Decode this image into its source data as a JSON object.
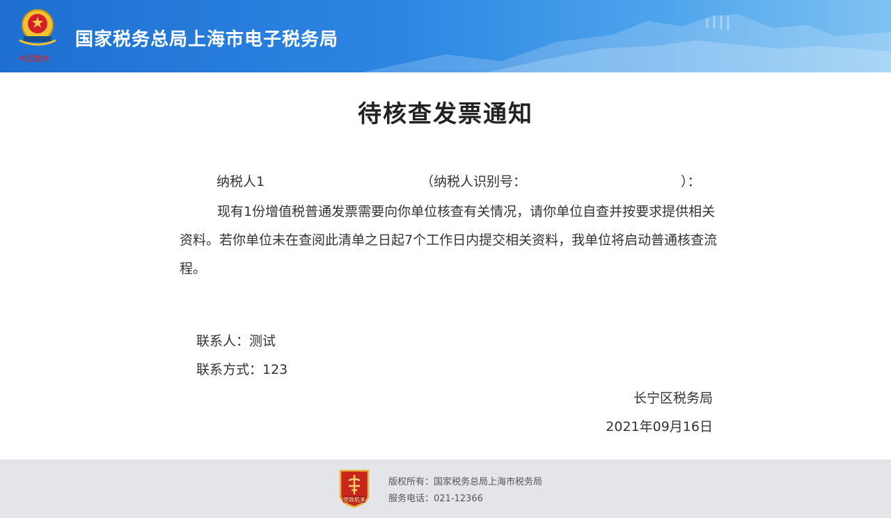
{
  "header": {
    "emblem_caption": "中国税务",
    "site_title": "国家税务总局上海市电子税务局"
  },
  "notice": {
    "title": "待核查发票通知",
    "taxpayer_label": "纳税人1",
    "taxpayer_id_open": "（纳税人识别号：",
    "taxpayer_id_close": "）：",
    "body": "现有1份增值税普通发票需要向你单位核查有关情况，请你单位自查并按要求提供相关资料。若你单位未在查阅此清单之日起7个工作日内提交相关资料，我单位将启动普通核查流程。",
    "contact_person": "联系人：测试",
    "contact_method": "联系方式：123",
    "issuer": "长宁区税务局",
    "date": "2021年09月16日"
  },
  "footer": {
    "badge_text": "党政机关",
    "copyright": "版权所有：国家税务总局上海市税务局",
    "service_phone": "服务电话：021-12366"
  },
  "colors": {
    "header_blue": "#2d86e2",
    "footer_gray": "#e4e5e8",
    "emblem_red": "#d3202a"
  }
}
